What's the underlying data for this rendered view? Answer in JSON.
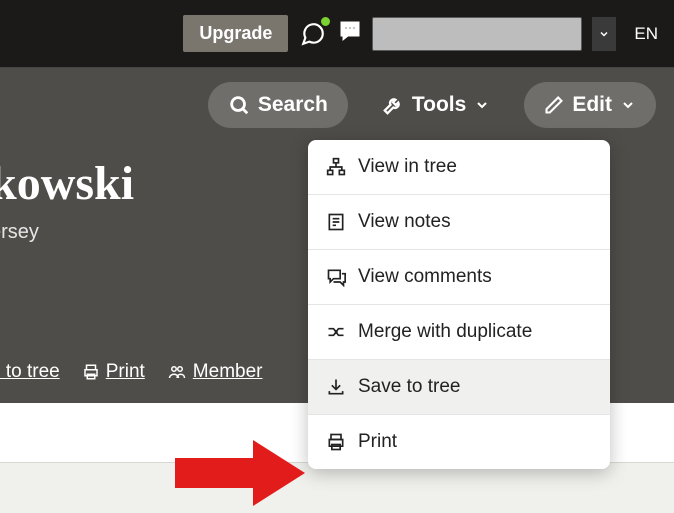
{
  "topbar": {
    "upgrade_label": "Upgrade",
    "language": "EN"
  },
  "actions": {
    "search_label": "Search",
    "tools_label": "Tools",
    "edit_label": "Edit"
  },
  "profile": {
    "name_partial": "kowski",
    "location_partial": "ersey"
  },
  "links": {
    "to_tree": "e to tree",
    "print": "Print",
    "member": "Member"
  },
  "tools_menu": {
    "items": [
      {
        "label": "View in tree"
      },
      {
        "label": "View notes"
      },
      {
        "label": "View comments"
      },
      {
        "label": "Merge with duplicate"
      },
      {
        "label": "Save to tree"
      },
      {
        "label": "Print"
      }
    ]
  }
}
